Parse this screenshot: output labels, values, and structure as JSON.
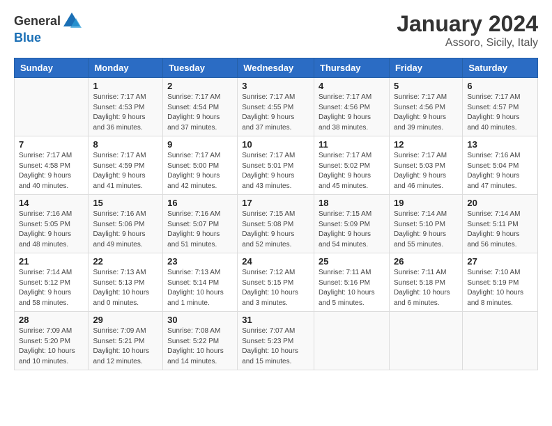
{
  "header": {
    "logo_general": "General",
    "logo_blue": "Blue",
    "month": "January 2024",
    "location": "Assoro, Sicily, Italy"
  },
  "days_of_week": [
    "Sunday",
    "Monday",
    "Tuesday",
    "Wednesday",
    "Thursday",
    "Friday",
    "Saturday"
  ],
  "weeks": [
    [
      {
        "num": "",
        "info": ""
      },
      {
        "num": "1",
        "info": "Sunrise: 7:17 AM\nSunset: 4:53 PM\nDaylight: 9 hours\nand 36 minutes."
      },
      {
        "num": "2",
        "info": "Sunrise: 7:17 AM\nSunset: 4:54 PM\nDaylight: 9 hours\nand 37 minutes."
      },
      {
        "num": "3",
        "info": "Sunrise: 7:17 AM\nSunset: 4:55 PM\nDaylight: 9 hours\nand 37 minutes."
      },
      {
        "num": "4",
        "info": "Sunrise: 7:17 AM\nSunset: 4:56 PM\nDaylight: 9 hours\nand 38 minutes."
      },
      {
        "num": "5",
        "info": "Sunrise: 7:17 AM\nSunset: 4:56 PM\nDaylight: 9 hours\nand 39 minutes."
      },
      {
        "num": "6",
        "info": "Sunrise: 7:17 AM\nSunset: 4:57 PM\nDaylight: 9 hours\nand 40 minutes."
      }
    ],
    [
      {
        "num": "7",
        "info": "Sunrise: 7:17 AM\nSunset: 4:58 PM\nDaylight: 9 hours\nand 40 minutes."
      },
      {
        "num": "8",
        "info": "Sunrise: 7:17 AM\nSunset: 4:59 PM\nDaylight: 9 hours\nand 41 minutes."
      },
      {
        "num": "9",
        "info": "Sunrise: 7:17 AM\nSunset: 5:00 PM\nDaylight: 9 hours\nand 42 minutes."
      },
      {
        "num": "10",
        "info": "Sunrise: 7:17 AM\nSunset: 5:01 PM\nDaylight: 9 hours\nand 43 minutes."
      },
      {
        "num": "11",
        "info": "Sunrise: 7:17 AM\nSunset: 5:02 PM\nDaylight: 9 hours\nand 45 minutes."
      },
      {
        "num": "12",
        "info": "Sunrise: 7:17 AM\nSunset: 5:03 PM\nDaylight: 9 hours\nand 46 minutes."
      },
      {
        "num": "13",
        "info": "Sunrise: 7:16 AM\nSunset: 5:04 PM\nDaylight: 9 hours\nand 47 minutes."
      }
    ],
    [
      {
        "num": "14",
        "info": "Sunrise: 7:16 AM\nSunset: 5:05 PM\nDaylight: 9 hours\nand 48 minutes."
      },
      {
        "num": "15",
        "info": "Sunrise: 7:16 AM\nSunset: 5:06 PM\nDaylight: 9 hours\nand 49 minutes."
      },
      {
        "num": "16",
        "info": "Sunrise: 7:16 AM\nSunset: 5:07 PM\nDaylight: 9 hours\nand 51 minutes."
      },
      {
        "num": "17",
        "info": "Sunrise: 7:15 AM\nSunset: 5:08 PM\nDaylight: 9 hours\nand 52 minutes."
      },
      {
        "num": "18",
        "info": "Sunrise: 7:15 AM\nSunset: 5:09 PM\nDaylight: 9 hours\nand 54 minutes."
      },
      {
        "num": "19",
        "info": "Sunrise: 7:14 AM\nSunset: 5:10 PM\nDaylight: 9 hours\nand 55 minutes."
      },
      {
        "num": "20",
        "info": "Sunrise: 7:14 AM\nSunset: 5:11 PM\nDaylight: 9 hours\nand 56 minutes."
      }
    ],
    [
      {
        "num": "21",
        "info": "Sunrise: 7:14 AM\nSunset: 5:12 PM\nDaylight: 9 hours\nand 58 minutes."
      },
      {
        "num": "22",
        "info": "Sunrise: 7:13 AM\nSunset: 5:13 PM\nDaylight: 10 hours\nand 0 minutes."
      },
      {
        "num": "23",
        "info": "Sunrise: 7:13 AM\nSunset: 5:14 PM\nDaylight: 10 hours\nand 1 minute."
      },
      {
        "num": "24",
        "info": "Sunrise: 7:12 AM\nSunset: 5:15 PM\nDaylight: 10 hours\nand 3 minutes."
      },
      {
        "num": "25",
        "info": "Sunrise: 7:11 AM\nSunset: 5:16 PM\nDaylight: 10 hours\nand 5 minutes."
      },
      {
        "num": "26",
        "info": "Sunrise: 7:11 AM\nSunset: 5:18 PM\nDaylight: 10 hours\nand 6 minutes."
      },
      {
        "num": "27",
        "info": "Sunrise: 7:10 AM\nSunset: 5:19 PM\nDaylight: 10 hours\nand 8 minutes."
      }
    ],
    [
      {
        "num": "28",
        "info": "Sunrise: 7:09 AM\nSunset: 5:20 PM\nDaylight: 10 hours\nand 10 minutes."
      },
      {
        "num": "29",
        "info": "Sunrise: 7:09 AM\nSunset: 5:21 PM\nDaylight: 10 hours\nand 12 minutes."
      },
      {
        "num": "30",
        "info": "Sunrise: 7:08 AM\nSunset: 5:22 PM\nDaylight: 10 hours\nand 14 minutes."
      },
      {
        "num": "31",
        "info": "Sunrise: 7:07 AM\nSunset: 5:23 PM\nDaylight: 10 hours\nand 15 minutes."
      },
      {
        "num": "",
        "info": ""
      },
      {
        "num": "",
        "info": ""
      },
      {
        "num": "",
        "info": ""
      }
    ]
  ]
}
